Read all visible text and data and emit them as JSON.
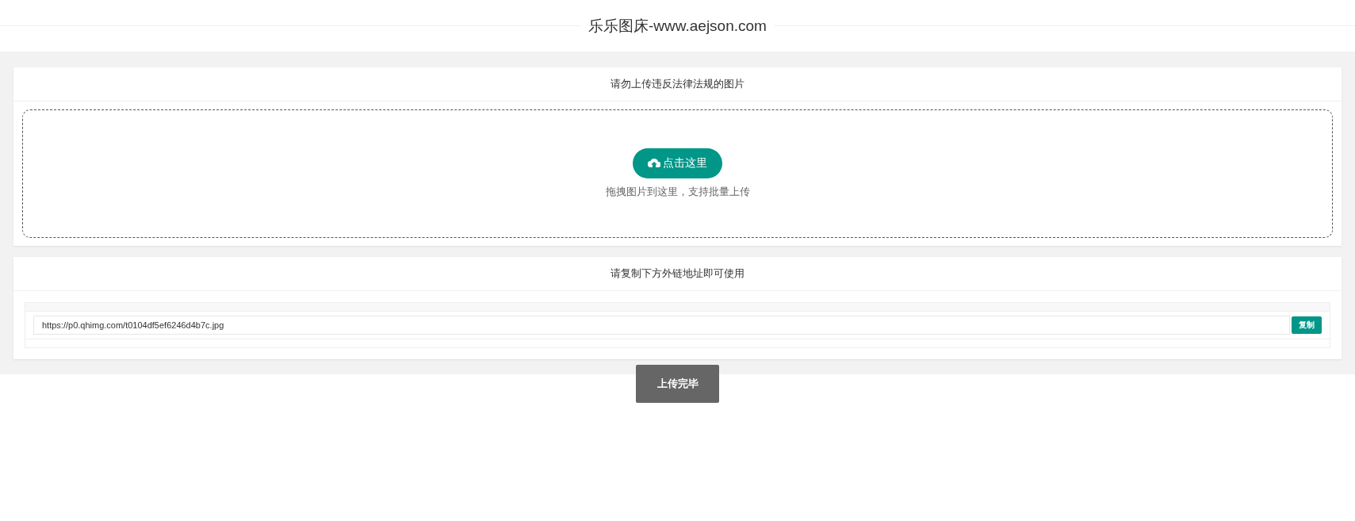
{
  "header": {
    "title": "乐乐图床-www.aejson.com"
  },
  "upload_card": {
    "notice": "请勿上传违反法律法规的图片",
    "button": "点击这里",
    "hint": "拖拽图片到这里，支持批量上传"
  },
  "links_card": {
    "title": "请复制下方外链地址即可使用",
    "links": [
      {
        "url": "https://p0.qhimg.com/t0104df5ef6246d4b7c.jpg",
        "copy": "复制"
      }
    ]
  },
  "done_button": "上传完毕"
}
